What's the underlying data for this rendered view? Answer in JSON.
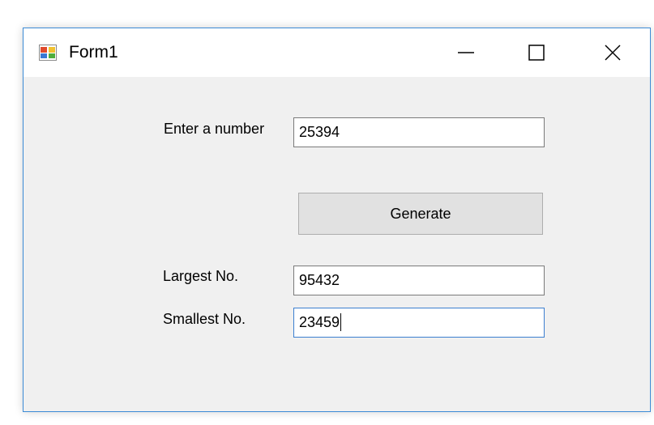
{
  "window": {
    "title": "Form1",
    "icon": "winforms-app-icon",
    "controls": {
      "minimize_icon": "minimize-icon",
      "maximize_icon": "maximize-icon",
      "close_icon": "close-icon"
    }
  },
  "form": {
    "number_label": "Enter a number",
    "number_value": "25394",
    "generate_label": "Generate",
    "largest_label": "Largest No.",
    "largest_value": "95432",
    "smallest_label": "Smallest No.",
    "smallest_value": "23459"
  },
  "colors": {
    "window_border": "#3c8bd6",
    "client_background": "#f0f0f0",
    "button_background": "#e1e1e1",
    "focus_border": "#3c7fd0"
  }
}
